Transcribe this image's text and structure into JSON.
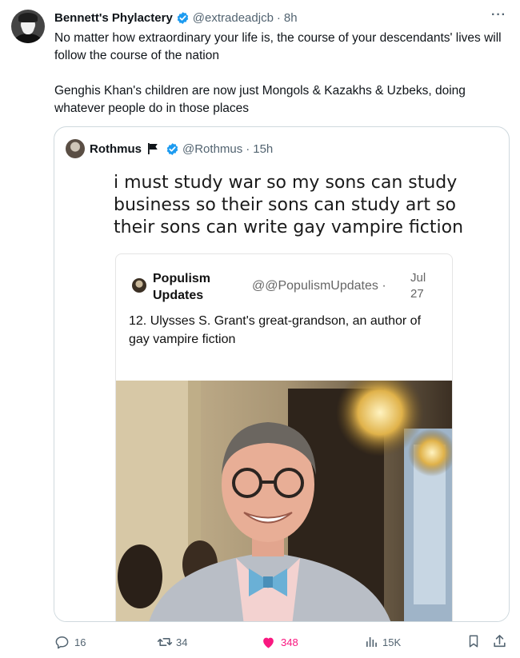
{
  "tweet": {
    "author_name": "Bennett's Phylactery",
    "handle": "@extradeadjcb",
    "separator": "·",
    "time": "8h",
    "more_label": "···",
    "paragraphs": [
      "No matter how extraordinary your life is, the course of your descendants' lives will follow the course of the nation",
      "Genghis Khan's children are now just Mongols & Kazakhs & Uzbeks, doing whatever people do in those places"
    ]
  },
  "quote": {
    "author_name": "Rothmus",
    "handle": "@Rothmus",
    "separator": "·",
    "time": "15h",
    "meme_caption": "i must study war so my sons can study business so their sons can study art so their sons can write gay vampire fiction",
    "inner_card": {
      "name": "Populism Updates",
      "handle": "@@PopulismUpdates ·",
      "date": "Jul 27",
      "text": "12. Ulysses S. Grant's great-grandson, an author of gay vampire fiction"
    }
  },
  "actions": {
    "replies": "16",
    "reposts": "34",
    "likes": "348",
    "views": "15K"
  },
  "colors": {
    "verified_blue": "#1d9bf0",
    "like_pink": "#f91880",
    "secondary_text": "#536471"
  },
  "icons": [
    "reply-icon",
    "repost-icon",
    "like-icon",
    "views-icon",
    "bookmark-icon",
    "share-icon",
    "verified-icon",
    "flag-icon",
    "more-icon"
  ]
}
